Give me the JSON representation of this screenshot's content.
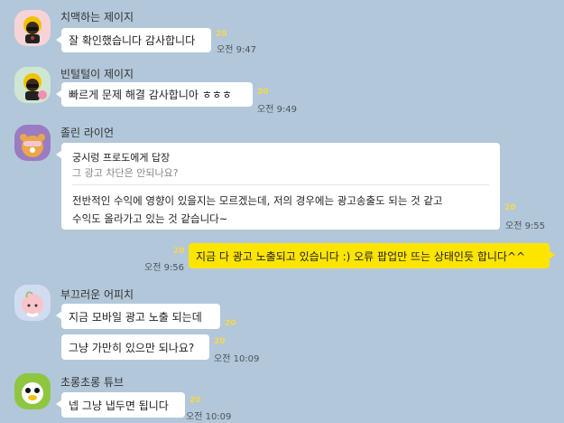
{
  "unread_count": "20",
  "messages": [
    {
      "sender": "치맥하는 제이지",
      "avatar": "jay-g-chimaek-avatar",
      "bubbles": [
        {
          "text": "잘 확인했습니다 감사합니다",
          "time": "오전 9:47"
        }
      ]
    },
    {
      "sender": "빈털털이 제이지",
      "avatar": "jay-g-broke-avatar",
      "bubbles": [
        {
          "text": "빠르게 문제 해결 감사합니아 ㅎㅎㅎ",
          "time": "오전 9:49"
        }
      ]
    },
    {
      "sender": "졸린 라이언",
      "avatar": "sleepy-ryan-avatar",
      "reply": {
        "to": "궁시렁 프로도에게 답장",
        "quote": "그 광고 차단은 안되나요?",
        "line1": "전반적인 수익에 영향이 있을지는 모르겠는데, 저의 경우에는 광고송출도 되는 것 같고",
        "line2": "수익도 올라가고 있는 것 같습니다~",
        "time": "오전 9:55"
      }
    },
    {
      "sender": "",
      "mine": true,
      "bubbles": [
        {
          "text": "지금 다 광고 노출되고 있습니다 :) 오류 팝업만 뜨는 상태인듯 합니다^^",
          "time": "오전 9:56"
        }
      ]
    },
    {
      "sender": "부끄러운 어피치",
      "avatar": "shy-apeach-avatar",
      "bubbles": [
        {
          "text": "지금 모바일 광고 노출 되는데",
          "time": ""
        },
        {
          "text": "그냥 가만히 있으만 되나요?",
          "time": "오전 10:09"
        }
      ]
    },
    {
      "sender": "초롱초롱 튜브",
      "avatar": "sparkling-tube-avatar",
      "bubbles": [
        {
          "text": "넵 그냥 냅두면 됩니다",
          "time": "오전 10:09"
        }
      ]
    }
  ]
}
